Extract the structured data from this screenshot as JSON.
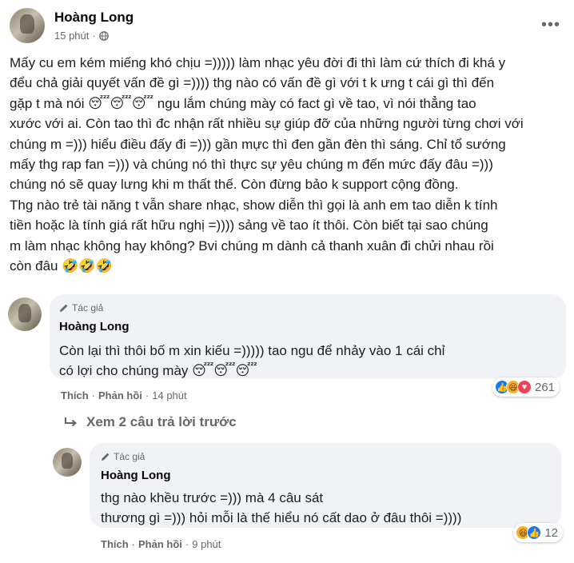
{
  "post": {
    "author": "Hoàng Long",
    "time": "15 phút",
    "more_label": "•••",
    "text": "Mấy cu em kém miếng khó chịu =))))) làm nhạc yêu đời đi thì  làm cứ thích đi khá y\nđểu chả giải quyết vấn đề gì =)))) thg nào có vấn đề gì với t k ưng t cái gì thì đến\ngặp t mà nói 😴😴😴 ngu lắm chúng mày  có fact gì về tao, vì nói thẳng tao \nxước với ai. Còn tao thì đc nhận rất nhiều sự giúp đỡ của những người từng chơi với\nchúng m =))) hiểu điều đấy đi =))) gần mực thì đen gần đèn thì sáng. Chỉ tổ sướng\nmấy thg rap fan =))) và chúng nó thì thực sự  yêu chúng m đến mức đấy đâu =)))\nchúng nó sẽ quay lưng khi m thất thế. Còn đừng bảo   k support cộng đồng.\nThg nào trẻ tài năng t vẫn share nhạc, show diễn thì gọi là anh em tao diễn k tính\ntiền hoặc là tính giá rất hữu nghị =)))) sảng  về tao ít thôi. Còn biết tại sao chúng\nm làm nhạc không hay không? Bvi chúng m dành cả thanh xuân đi chửi nhau rồi\ncòn đâu 🤣🤣🤣"
  },
  "comments": [
    {
      "badge": "Tác giả",
      "author": "Hoàng Long",
      "text": "Còn   lại thì thôi bố m xin kiếu =))))) tao  ngu để nhảy vào 1 cái chỉ\ncó lợi cho chúng mày 😴😴😴",
      "like_label": "Thích",
      "reply_label": "Phản hồi",
      "time": "14 phút",
      "reaction_count": "261",
      "reactions": [
        "like-icon",
        "haha-icon",
        "love-icon"
      ]
    },
    {
      "badge": "Tác giả",
      "author": "Hoàng Long",
      "text": "thg nào khều trước =))) mà 4 câu     sát\nthương gì =))) hỏi mỗi là thế  hiểu nó cất dao ở đâu thôi =))))",
      "like_label": "Thích",
      "reply_label": "Phản hồi",
      "time": "9 phút",
      "reaction_count": "12",
      "reactions": [
        "haha-icon",
        "like-icon"
      ]
    }
  ],
  "view_previous_replies": "Xem 2 câu trả lời trước",
  "separator": "·"
}
